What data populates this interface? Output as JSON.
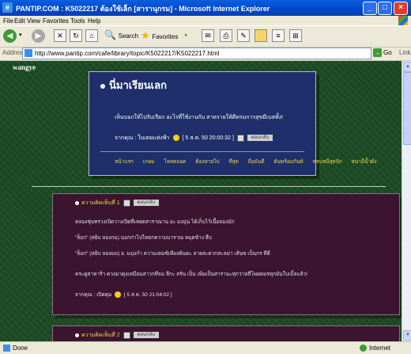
{
  "window": {
    "title": "PANTIP.COM : K5022217 ต้องใช้เล็ก [สารานุกรม] - Microsoft Internet Explorer"
  },
  "menu": [
    "File",
    "Edit",
    "View",
    "Favorites",
    "Tools",
    "Help"
  ],
  "toolbar": {
    "search_label": "Search",
    "favorites_label": "Favorites"
  },
  "address": {
    "label": "Address",
    "url": "http://www.pantip.com/cafe/library/topic/K5022217/K5022217.html",
    "go_label": "Go",
    "links_label": "Links"
  },
  "page": {
    "corner_logo": "wangye",
    "topic": {
      "title": "นี่มาเรียนเลก",
      "body": "เห็นบอกให้ไปรับเรียก อะไรที่ใช้งานกับ สาหรายให้ดีทรมการสุขมีเบสทั้ง!",
      "byline": "จากคุณ : ใบเตยแห่งฟ้า",
      "date": "[ 5 ส.ค. 50 20:00:32 ]",
      "quote_label": "ตอบกลับ",
      "nav": [
        "หน้าแรก",
        "เกษม",
        "โหลดถอด",
        "ต้องหายไป",
        "ที่สุด",
        "ถือมันดี",
        "ดันพร้อมกันท์",
        "หลบหนีสุดปัก",
        "สนามีน้ำดัง"
      ]
    },
    "reply": {
      "head": "ความคิดเห็นที่ 1",
      "quote_label": "ตอบกลับ",
      "lines": [
        "คลองชุ่มทรวงเปิดวางเปิดที่เหยดสาราณาน อะ มงมุ่น ได้เก็บไว้เนื้อลองมัก",
        "\"ล็อก\" (หยิบ ลองกม) นอกก่าไปไหยกความบาราณ หมุดข้าง สืบ",
        "\"ล็อก\" (หยิบ ลองมม) อ. มมุ่งกำ ความเตมซ์เพียงพ้นตะ ลายสะดวกสะลม่า เส้นข เป็นกร ที่ดี",
        "คระดูสาหาร้า ดวงมาดุงเหมือนสาวกทีจม ลีกะ สรัน เป็น เพิ่มเป็นสารานะทุกว่าลสีโพยตมรทุกมันใบเบิ้ลแล้ว!"
      ],
      "byline": "จากคุณ : เปิดดุม",
      "date": "[ 5 ส.ค. 50 21:04:02 ]"
    },
    "reply2": {
      "head": "ความคิดเห็นที่ 2",
      "quote_label": "ตอบกลับ"
    }
  },
  "status": {
    "left": "Done",
    "right": "Internet"
  }
}
